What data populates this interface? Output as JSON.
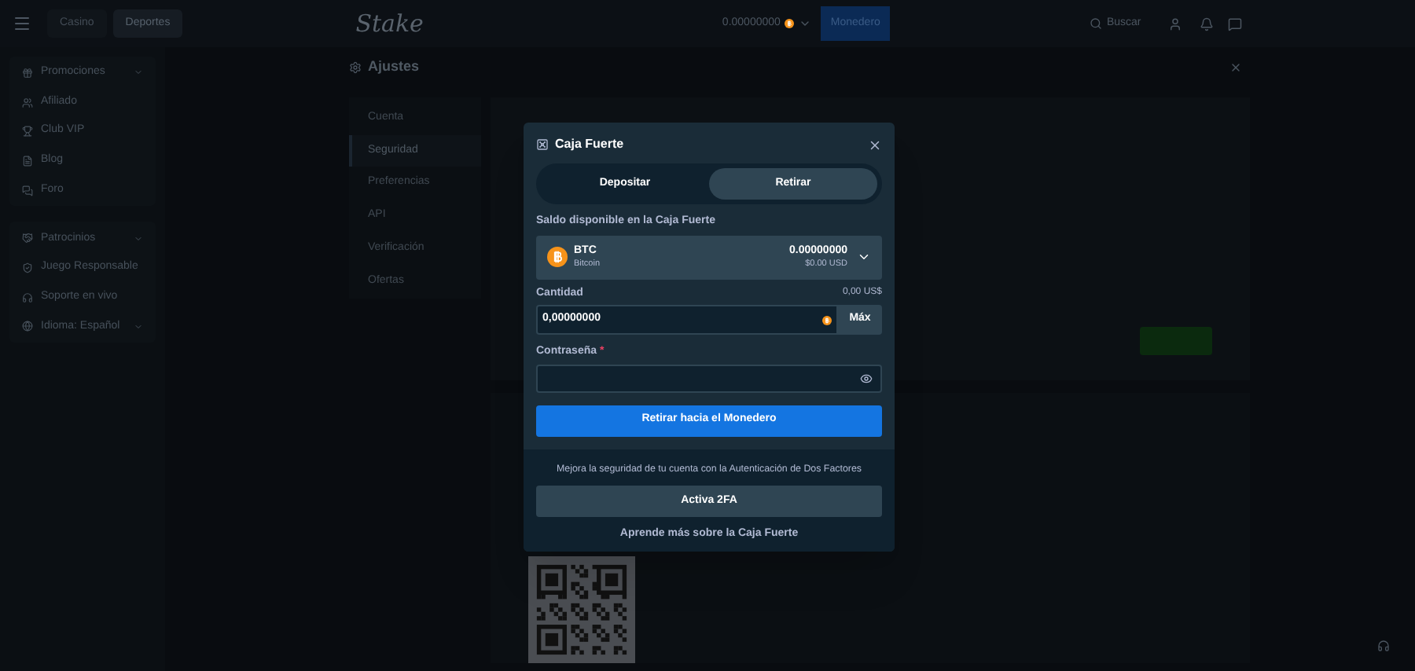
{
  "topbar": {
    "tabs": [
      {
        "label": "Casino",
        "selected": false
      },
      {
        "label": "Deportes",
        "selected": true
      }
    ],
    "logo": "Stake",
    "balance": "0.00000000",
    "wallet_button": "Monedero",
    "search": "Buscar"
  },
  "sidebar": {
    "groups": [
      [
        {
          "label": "Promociones",
          "kind": "group"
        },
        {
          "label": "Afiliado",
          "kind": "link"
        },
        {
          "label": "Club VIP",
          "kind": "link"
        },
        {
          "label": "Blog",
          "kind": "link"
        },
        {
          "label": "Foro",
          "kind": "link"
        }
      ],
      [
        {
          "label": "Patrocinios",
          "kind": "group"
        },
        {
          "label": "Juego Responsable",
          "kind": "link"
        },
        {
          "label": "Soporte en vivo",
          "kind": "link"
        },
        {
          "label": "Idioma: Español",
          "kind": "group"
        }
      ]
    ]
  },
  "settings": {
    "title": "Ajustes",
    "nav": [
      {
        "label": "Cuenta",
        "selected": false
      },
      {
        "label": "Seguridad",
        "selected": true
      },
      {
        "label": "Preferencias",
        "selected": false
      },
      {
        "label": "API",
        "selected": false
      },
      {
        "label": "Verificación",
        "selected": false
      },
      {
        "label": "Ofertas",
        "selected": false
      }
    ]
  },
  "modal": {
    "title": "Caja Fuerte",
    "tabs": [
      {
        "label": "Depositar",
        "selected": false
      },
      {
        "label": "Retirar",
        "selected": true
      }
    ],
    "balance_label": "Saldo disponible en la Caja Fuerte",
    "currency": {
      "code": "BTC",
      "name": "Bitcoin",
      "amount": "0.00000000",
      "usd": "$0.00 USD"
    },
    "amount_label": "Cantidad",
    "amount_usd": "0,00 US$",
    "amount_value": "0,00000000",
    "max_button": "Máx",
    "password_label": "Contraseña",
    "required_mark": "*",
    "submit_button": "Retirar hacia el Monedero",
    "twofa_text": "Mejora la seguridad de tu cuenta con la Autenticación de Dos Factores",
    "twofa_button": "Activa 2FA",
    "learn_link": "Aprende más sobre la Caja Fuerte"
  }
}
